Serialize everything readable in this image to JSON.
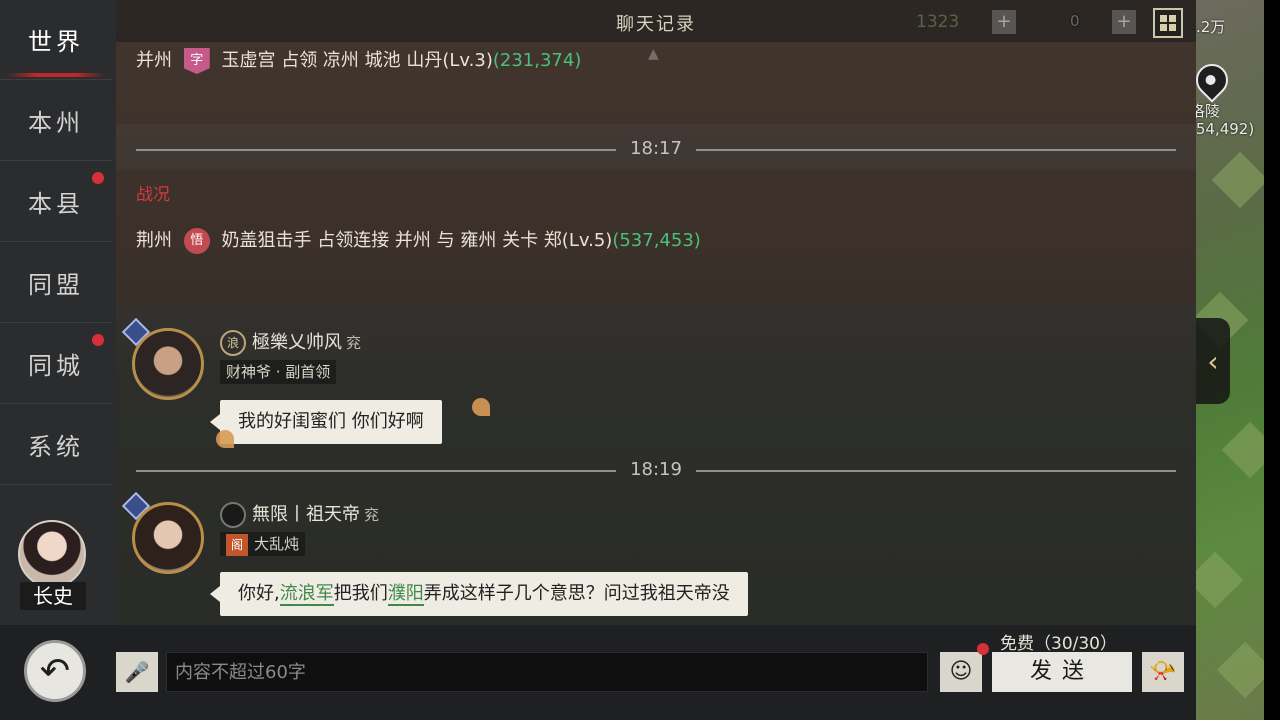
{
  "header": {
    "title": "聊天记录",
    "gem_count": "1323",
    "plus_label": "+",
    "zero_count": "0"
  },
  "sidebar": {
    "tabs": [
      {
        "label": "世界",
        "active": true,
        "badge": false
      },
      {
        "label": "本州",
        "active": false,
        "badge": false
      },
      {
        "label": "本县",
        "active": false,
        "badge": true
      },
      {
        "label": "同盟",
        "active": false,
        "badge": false
      },
      {
        "label": "同城",
        "active": false,
        "badge": true
      },
      {
        "label": "系统",
        "active": false,
        "badge": false
      }
    ],
    "role": "长史"
  },
  "map": {
    "place": "洛陵",
    "coords": "(54,492)",
    "count": ".2万"
  },
  "messages": {
    "sys1": {
      "region": "并州",
      "badge": "字",
      "text": "玉虚宫 占领 凉州 城池 山丹(Lv.3)",
      "coords": "(231,374)"
    },
    "time1": "18:17",
    "war_label": "战况",
    "sys2": {
      "region": "荆州",
      "badge": "悟",
      "text": "奶盖狙击手 占领连接 并州 与 雍州 关卡 郑(Lv.5)",
      "coords": "(537,453)"
    },
    "chat1": {
      "crest": "浪",
      "name": "極樂乂帅风",
      "province": "兖",
      "tag": "财神爷 · 副首领",
      "text": "我的好闺蜜们  你们好啊"
    },
    "time2": "18:19",
    "chat2": {
      "name": "無限丨祖天帝",
      "province": "兖",
      "tag_icon": "阁",
      "tag": "大乱炖",
      "text_before": "你好,",
      "hl1": "流浪军",
      "text_mid": "把我们",
      "hl2": "濮阳",
      "text_after": "弄成这样子几个意思？问过我祖天帝没"
    }
  },
  "input": {
    "placeholder": "内容不超过60字",
    "free_quota": "免费（30/30）",
    "send_label": "发送"
  },
  "icons": {
    "back": "back-arrow-icon",
    "mic": "microphone-icon",
    "emoji": "emoji-icon",
    "horn": "horn-icon",
    "grid": "grid-menu-icon",
    "pin": "map-pin-icon",
    "collapse": "chevron-left-icon"
  }
}
